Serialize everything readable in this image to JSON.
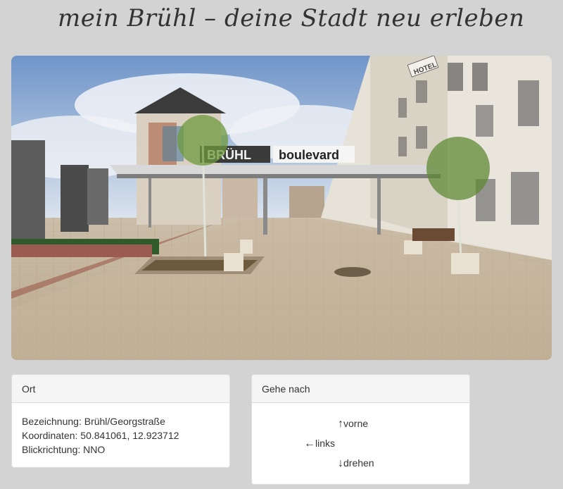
{
  "header": {
    "title": "mein Brühl – deine Stadt neu erleben"
  },
  "photo": {
    "sign_bruhl": "BRÜHL",
    "sign_boulevard": "boulevard",
    "sign_hotel": "HOTEL"
  },
  "ort_panel": {
    "heading": "Ort",
    "bezeichnung": "Bezeichnung: Brühl/Georgstraße",
    "koordinaten": "Koordinaten: 50.841061, 12.923712",
    "blickrichtung": "Blickrichtung: NNO"
  },
  "gehe_panel": {
    "heading": "Gehe nach",
    "links": [
      {
        "arrow": "↑",
        "label": "vorne"
      },
      {
        "arrow": "←",
        "label": "links"
      },
      {
        "arrow": "↓",
        "label": "drehen"
      }
    ]
  }
}
